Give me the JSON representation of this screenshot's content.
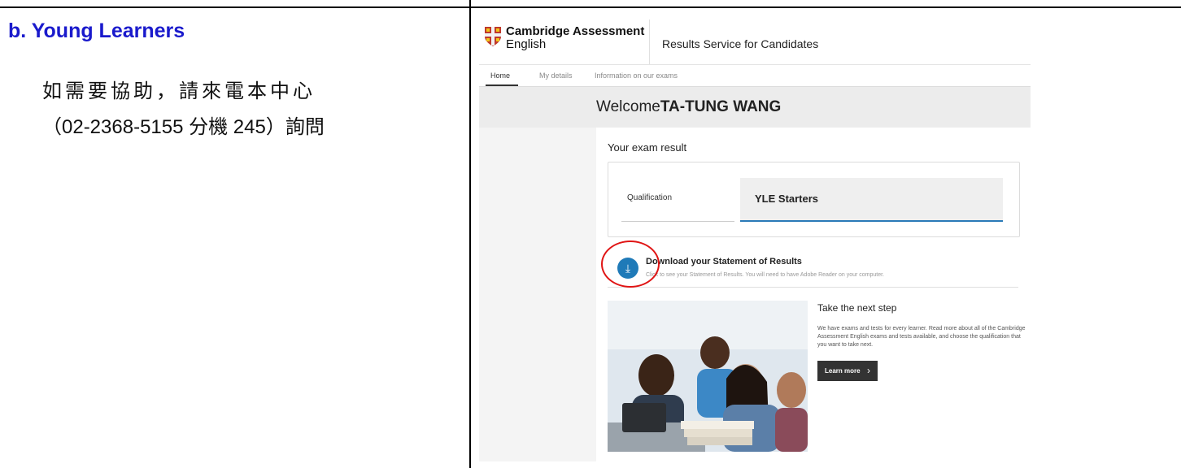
{
  "section": {
    "title": "b. Young Learners",
    "help_line1": "如需要協助，請來電本中心",
    "help_line2": "（02-2368-5155 分機 245）詢問"
  },
  "app": {
    "logo_line1": "Cambridge Assessment",
    "logo_line2": "English",
    "service_title": "Results Service for Candidates",
    "brand_color": "#1f7ab8"
  },
  "nav": {
    "tabs": [
      {
        "label": "Home",
        "active": true
      },
      {
        "label": "My details",
        "active": false
      },
      {
        "label": "Information on our exams",
        "active": false
      }
    ]
  },
  "welcome": {
    "greeting": "Welcome",
    "name": "TA-TUNG WANG"
  },
  "exam": {
    "heading": "Your exam result",
    "qualification_label": "Qualification",
    "qualification_value": "YLE Starters"
  },
  "download": {
    "icon": "download-icon",
    "title": "Download your Statement of Results",
    "subtitle": "Click to see your Statement of Results. You will need to have Adobe Reader on your computer."
  },
  "promo": {
    "title": "Take the next step",
    "body": "We have exams and tests for every learner. Read more about all of the Cambridge Assessment English exams and tests available, and choose the qualification that you want to take next.",
    "button_label": "Learn more",
    "button_icon": "chevron-right-icon"
  }
}
